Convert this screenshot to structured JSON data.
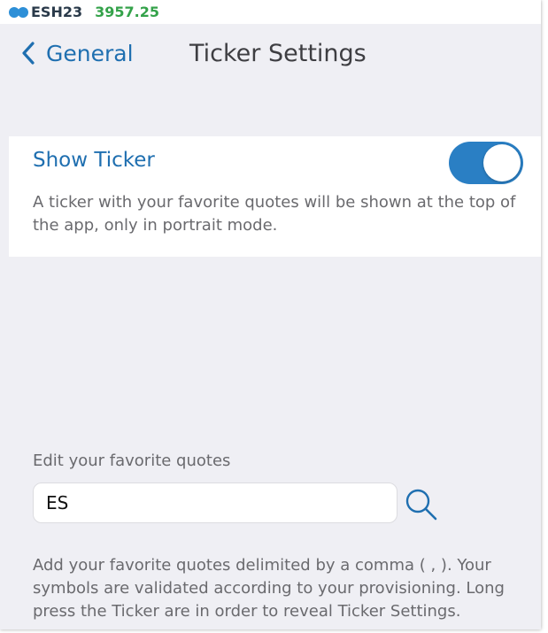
{
  "ticker": {
    "symbol": "ESH23",
    "price": "3957.25",
    "price_color": "#34a24a"
  },
  "nav": {
    "back_label": "General",
    "back_icon": "chevron-left-icon",
    "title": "Ticker Settings"
  },
  "show_ticker": {
    "label": "Show Ticker",
    "enabled": true,
    "description": "A ticker with your favorite quotes will be shown at the top of the app, only in portrait mode."
  },
  "quotes": {
    "label": "Edit your favorite quotes",
    "value": "ES",
    "search_icon": "search-icon",
    "help": "Add your favorite quotes delimited by a comma ( , ). Your symbols are validated according to your provisioning. Long press the Ticker are in order to reveal Ticker Settings."
  },
  "colors": {
    "accent": "#1f6fb0",
    "toggle_on": "#2a7fc4",
    "background": "#efeff4"
  }
}
